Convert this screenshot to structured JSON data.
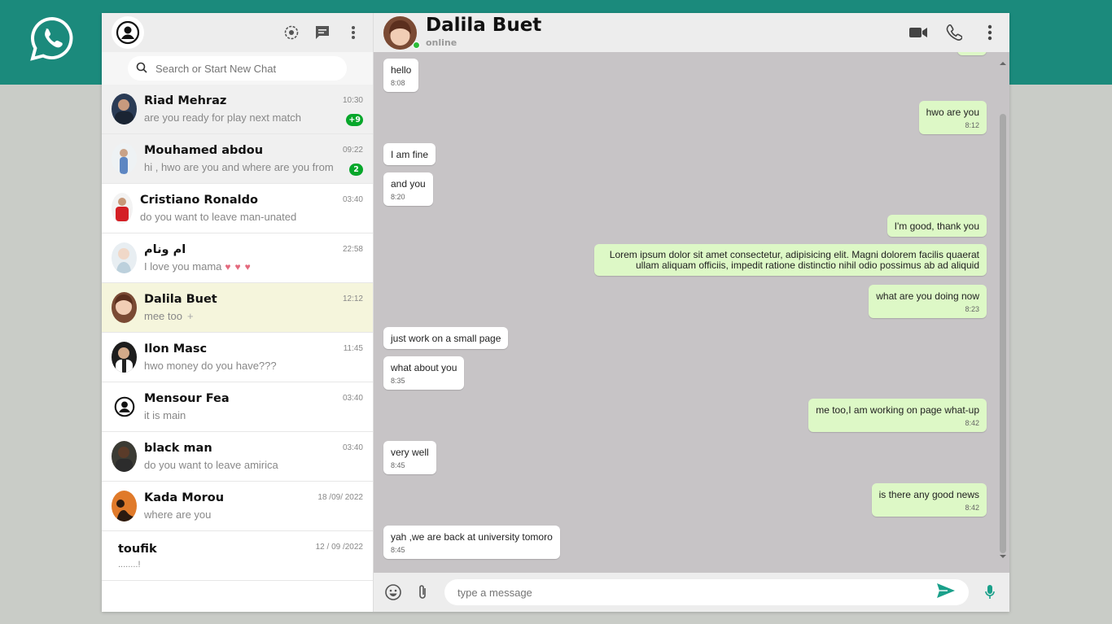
{
  "colors": {
    "brand": "#1b8a7c",
    "badge": "#07a72b",
    "outgoing": "#ddf8c6",
    "active_row": "#f5f5dc"
  },
  "sidebar": {
    "search_placeholder": "Search or Start New Chat",
    "icons": [
      "status-icon",
      "new-chat-icon",
      "menu-icon"
    ],
    "chats": [
      {
        "name": "Riad Mehraz",
        "msg": "are you ready for play next match",
        "time": "10:30",
        "badge": "+9"
      },
      {
        "name": "Mouhamed abdou",
        "msg": "hi , hwo are you and where are you from",
        "time": "09:22",
        "badge": "2"
      },
      {
        "name": "Cristiano Ronaldo",
        "msg": "do you want to leave man-unated",
        "time": "03:40"
      },
      {
        "name": "ام ونام",
        "msg": "I love you mama",
        "time": "22:58",
        "hearts": "♥♥♥"
      },
      {
        "name": "Dalila Buet",
        "msg": "mee too",
        "time": "12:12"
      },
      {
        "name": "Ilon Masc",
        "msg": "hwo money do you have???",
        "time": "11:45"
      },
      {
        "name": "Mensour Fea",
        "msg": "it is main",
        "time": "03:40"
      },
      {
        "name": "black man",
        "msg": "do you want to leave amirica",
        "time": "03:40"
      },
      {
        "name": "Kada Morou",
        "msg": "where are you",
        "time": "18 /09/ 2022"
      },
      {
        "name": "toufik",
        "msg": "........!",
        "time": "12 / 09 /2022"
      }
    ]
  },
  "chat": {
    "name": "Dalila Buet",
    "status": "online",
    "composer_placeholder": "type a message",
    "messages": [
      {
        "dir": "in",
        "text": "hello",
        "time": "8:08"
      },
      {
        "dir": "out",
        "text": "hwo are you",
        "time": "8:12"
      },
      {
        "dir": "in",
        "text": "I am fine",
        "time": ""
      },
      {
        "dir": "in",
        "text": "and you",
        "time": "8:20"
      },
      {
        "dir": "out",
        "text": "I'm good, thank you",
        "time": ""
      },
      {
        "dir": "out",
        "text": "Lorem ipsum dolor sit amet consectetur, adipisicing elit. Magni dolorem facilis quaerat ullam aliquam officiis, impedit ratione distinctio nihil odio possimus ab ad aliquid",
        "time": ""
      },
      {
        "dir": "out",
        "text": "what are you doing now",
        "time": "8:23"
      },
      {
        "dir": "in",
        "text": "just work on a small page",
        "time": ""
      },
      {
        "dir": "in",
        "text": "what about you",
        "time": "8:35"
      },
      {
        "dir": "out",
        "text": "me too,I am working on page what-up",
        "time": "8:42"
      },
      {
        "dir": "in",
        "text": "very well",
        "time": "8:45"
      },
      {
        "dir": "out",
        "text": "is there any good news",
        "time": "8:42"
      },
      {
        "dir": "in",
        "text": "yah ,we are back at university tomoro",
        "time": "8:45"
      }
    ]
  }
}
